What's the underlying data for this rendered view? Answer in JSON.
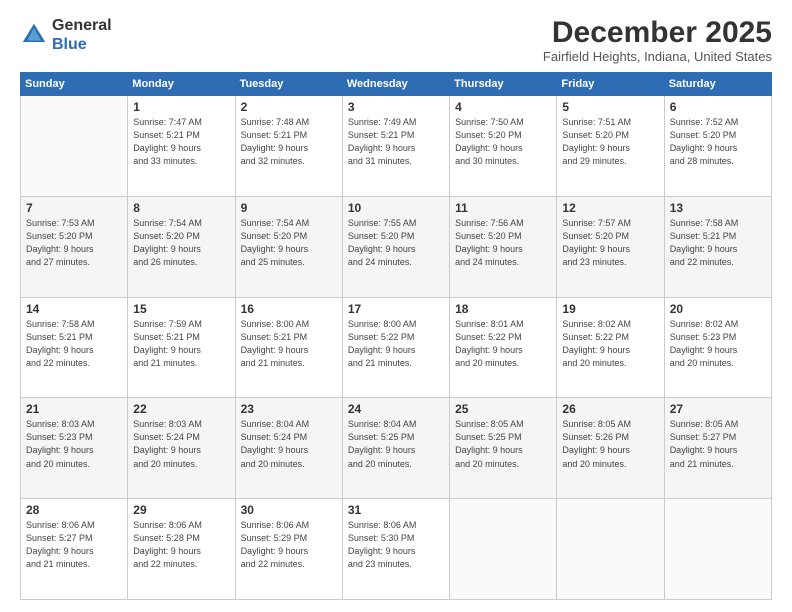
{
  "logo": {
    "general": "General",
    "blue": "Blue"
  },
  "title": "December 2025",
  "location": "Fairfield Heights, Indiana, United States",
  "weekdays": [
    "Sunday",
    "Monday",
    "Tuesday",
    "Wednesday",
    "Thursday",
    "Friday",
    "Saturday"
  ],
  "weeks": [
    [
      {
        "day": "",
        "info": ""
      },
      {
        "day": "1",
        "info": "Sunrise: 7:47 AM\nSunset: 5:21 PM\nDaylight: 9 hours\nand 33 minutes."
      },
      {
        "day": "2",
        "info": "Sunrise: 7:48 AM\nSunset: 5:21 PM\nDaylight: 9 hours\nand 32 minutes."
      },
      {
        "day": "3",
        "info": "Sunrise: 7:49 AM\nSunset: 5:21 PM\nDaylight: 9 hours\nand 31 minutes."
      },
      {
        "day": "4",
        "info": "Sunrise: 7:50 AM\nSunset: 5:20 PM\nDaylight: 9 hours\nand 30 minutes."
      },
      {
        "day": "5",
        "info": "Sunrise: 7:51 AM\nSunset: 5:20 PM\nDaylight: 9 hours\nand 29 minutes."
      },
      {
        "day": "6",
        "info": "Sunrise: 7:52 AM\nSunset: 5:20 PM\nDaylight: 9 hours\nand 28 minutes."
      }
    ],
    [
      {
        "day": "7",
        "info": "Sunrise: 7:53 AM\nSunset: 5:20 PM\nDaylight: 9 hours\nand 27 minutes."
      },
      {
        "day": "8",
        "info": "Sunrise: 7:54 AM\nSunset: 5:20 PM\nDaylight: 9 hours\nand 26 minutes."
      },
      {
        "day": "9",
        "info": "Sunrise: 7:54 AM\nSunset: 5:20 PM\nDaylight: 9 hours\nand 25 minutes."
      },
      {
        "day": "10",
        "info": "Sunrise: 7:55 AM\nSunset: 5:20 PM\nDaylight: 9 hours\nand 24 minutes."
      },
      {
        "day": "11",
        "info": "Sunrise: 7:56 AM\nSunset: 5:20 PM\nDaylight: 9 hours\nand 24 minutes."
      },
      {
        "day": "12",
        "info": "Sunrise: 7:57 AM\nSunset: 5:20 PM\nDaylight: 9 hours\nand 23 minutes."
      },
      {
        "day": "13",
        "info": "Sunrise: 7:58 AM\nSunset: 5:21 PM\nDaylight: 9 hours\nand 22 minutes."
      }
    ],
    [
      {
        "day": "14",
        "info": "Sunrise: 7:58 AM\nSunset: 5:21 PM\nDaylight: 9 hours\nand 22 minutes."
      },
      {
        "day": "15",
        "info": "Sunrise: 7:59 AM\nSunset: 5:21 PM\nDaylight: 9 hours\nand 21 minutes."
      },
      {
        "day": "16",
        "info": "Sunrise: 8:00 AM\nSunset: 5:21 PM\nDaylight: 9 hours\nand 21 minutes."
      },
      {
        "day": "17",
        "info": "Sunrise: 8:00 AM\nSunset: 5:22 PM\nDaylight: 9 hours\nand 21 minutes."
      },
      {
        "day": "18",
        "info": "Sunrise: 8:01 AM\nSunset: 5:22 PM\nDaylight: 9 hours\nand 20 minutes."
      },
      {
        "day": "19",
        "info": "Sunrise: 8:02 AM\nSunset: 5:22 PM\nDaylight: 9 hours\nand 20 minutes."
      },
      {
        "day": "20",
        "info": "Sunrise: 8:02 AM\nSunset: 5:23 PM\nDaylight: 9 hours\nand 20 minutes."
      }
    ],
    [
      {
        "day": "21",
        "info": "Sunrise: 8:03 AM\nSunset: 5:23 PM\nDaylight: 9 hours\nand 20 minutes."
      },
      {
        "day": "22",
        "info": "Sunrise: 8:03 AM\nSunset: 5:24 PM\nDaylight: 9 hours\nand 20 minutes."
      },
      {
        "day": "23",
        "info": "Sunrise: 8:04 AM\nSunset: 5:24 PM\nDaylight: 9 hours\nand 20 minutes."
      },
      {
        "day": "24",
        "info": "Sunrise: 8:04 AM\nSunset: 5:25 PM\nDaylight: 9 hours\nand 20 minutes."
      },
      {
        "day": "25",
        "info": "Sunrise: 8:05 AM\nSunset: 5:25 PM\nDaylight: 9 hours\nand 20 minutes."
      },
      {
        "day": "26",
        "info": "Sunrise: 8:05 AM\nSunset: 5:26 PM\nDaylight: 9 hours\nand 20 minutes."
      },
      {
        "day": "27",
        "info": "Sunrise: 8:05 AM\nSunset: 5:27 PM\nDaylight: 9 hours\nand 21 minutes."
      }
    ],
    [
      {
        "day": "28",
        "info": "Sunrise: 8:06 AM\nSunset: 5:27 PM\nDaylight: 9 hours\nand 21 minutes."
      },
      {
        "day": "29",
        "info": "Sunrise: 8:06 AM\nSunset: 5:28 PM\nDaylight: 9 hours\nand 22 minutes."
      },
      {
        "day": "30",
        "info": "Sunrise: 8:06 AM\nSunset: 5:29 PM\nDaylight: 9 hours\nand 22 minutes."
      },
      {
        "day": "31",
        "info": "Sunrise: 8:06 AM\nSunset: 5:30 PM\nDaylight: 9 hours\nand 23 minutes."
      },
      {
        "day": "",
        "info": ""
      },
      {
        "day": "",
        "info": ""
      },
      {
        "day": "",
        "info": ""
      }
    ]
  ]
}
